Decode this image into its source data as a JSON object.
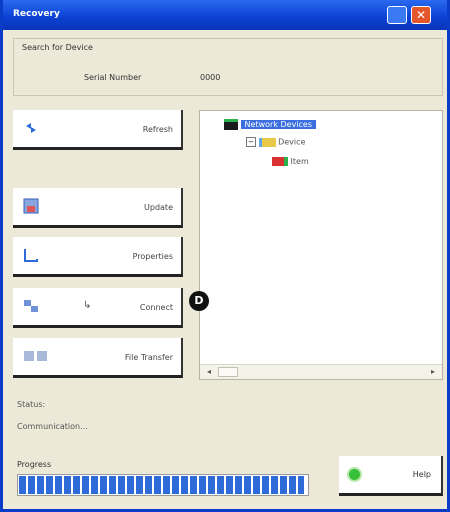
{
  "window": {
    "title": "Recovery"
  },
  "group": {
    "title": "Search for Device",
    "label": "Serial Number",
    "value": "0000"
  },
  "buttons": [
    {
      "name": "refresh",
      "label": "Refresh",
      "icon": "refresh-icon"
    },
    {
      "name": "update",
      "label": "Update",
      "icon": "disk-icon"
    },
    {
      "name": "properties",
      "label": "Properties",
      "icon": "page-icon"
    },
    {
      "name": "connect",
      "label": "Connect",
      "icon": "network-icon"
    },
    {
      "name": "transfer",
      "label": "File Transfer",
      "icon": "transfer-icon"
    }
  ],
  "tree": {
    "root": "Network Devices",
    "child": "Device",
    "leaf": "Item"
  },
  "status": {
    "line1": "Status:",
    "line2": "Communication..."
  },
  "progress": {
    "label": "Progress",
    "fraction": 0.99
  },
  "help": {
    "label": "Help"
  },
  "badge": {
    "text": "D"
  },
  "colors": {
    "titlebar": "#0b3fd2",
    "progress": "#2e6bd8",
    "close": "#e4562c"
  }
}
